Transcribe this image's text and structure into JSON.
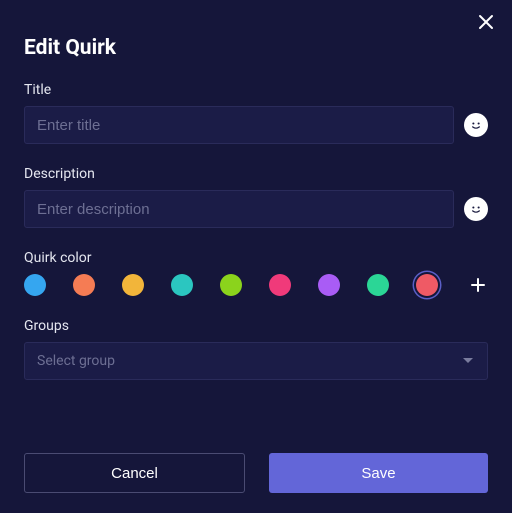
{
  "modal": {
    "title": "Edit Quirk"
  },
  "fields": {
    "title": {
      "label": "Title",
      "placeholder": "Enter title",
      "value": ""
    },
    "description": {
      "label": "Description",
      "placeholder": "Enter description",
      "value": ""
    },
    "color": {
      "label": "Quirk color"
    },
    "groups": {
      "label": "Groups",
      "placeholder": "Select group"
    }
  },
  "colors": [
    {
      "name": "blue",
      "hex": "#35a6f0",
      "selected": false
    },
    {
      "name": "orange",
      "hex": "#f57c54",
      "selected": false
    },
    {
      "name": "yellow",
      "hex": "#f2b53a",
      "selected": false
    },
    {
      "name": "teal",
      "hex": "#2bc6c0",
      "selected": false
    },
    {
      "name": "green",
      "hex": "#8bd31c",
      "selected": false
    },
    {
      "name": "pink",
      "hex": "#f03a7a",
      "selected": false
    },
    {
      "name": "purple",
      "hex": "#a95cf5",
      "selected": false
    },
    {
      "name": "mint",
      "hex": "#2bd696",
      "selected": false
    },
    {
      "name": "coral",
      "hex": "#ef5a65",
      "selected": true
    }
  ],
  "buttons": {
    "cancel": "Cancel",
    "save": "Save"
  }
}
